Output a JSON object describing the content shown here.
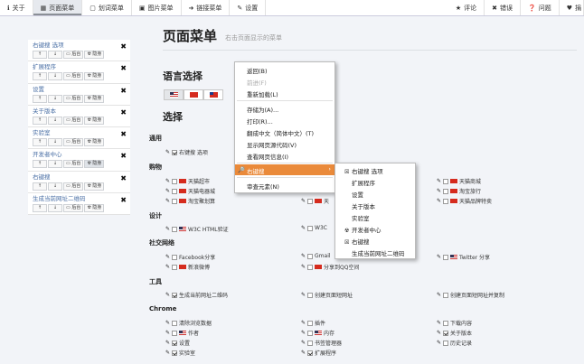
{
  "nav": {
    "tabs": [
      {
        "icon": "info-icon",
        "glyph": "ℹ",
        "label": "关于"
      },
      {
        "icon": "grid-icon",
        "glyph": "▦",
        "label": "页面菜单",
        "active": true
      },
      {
        "icon": "copy-icon",
        "glyph": "▢",
        "label": "划词菜单"
      },
      {
        "icon": "image-icon",
        "glyph": "▣",
        "label": "图片菜单"
      },
      {
        "icon": "link-icon",
        "glyph": "➜",
        "label": "链接菜单"
      },
      {
        "icon": "wrench-icon",
        "glyph": "✎",
        "label": "设置"
      }
    ],
    "right_tabs": [
      {
        "icon": "star-icon",
        "glyph": "★",
        "label": "评论"
      },
      {
        "icon": "close-icon",
        "glyph": "✖",
        "label": "错误"
      },
      {
        "icon": "question-icon",
        "glyph": "❓",
        "label": "问题"
      },
      {
        "icon": "heart-icon",
        "glyph": "♥",
        "label": "捐"
      }
    ]
  },
  "sidebar": {
    "buttons": {
      "up": "↑",
      "down": "↓",
      "back": "▭ 后台",
      "hide": "☢ 隐身"
    },
    "items": [
      {
        "label": "右键搜 选项"
      },
      {
        "label": "扩展程序"
      },
      {
        "label": "设置"
      },
      {
        "label": "关于版本"
      },
      {
        "label": "实验室"
      },
      {
        "label": "开发者中心"
      },
      {
        "label": "右键搜"
      },
      {
        "label": "生成当前网址二维码"
      }
    ]
  },
  "main": {
    "title": "页面菜单",
    "subtitle": "右击页面显示的菜单",
    "lang_title": "语言选择",
    "select_title": "选择",
    "sections": {
      "general": "通用",
      "shopping": "购物",
      "design": "设计",
      "social": "社交网络",
      "tools": "工具",
      "chrome": "Chrome"
    },
    "options": {
      "rs_opt": "右键搜 选项",
      "tmall_super": "天猫超市",
      "tmall_mall": "天猫商城",
      "tmall_elec": "天猫电器城",
      "taobao_travel": "淘宝旅行",
      "taobao_ju": "淘宝聚划算",
      "tmall_brand": "天猫品牌特卖",
      "tian_partial": "天",
      "w3c_html": "W3C HTML验证",
      "w3c_partial": "W3C",
      "facebook": "Facebook分享",
      "gmail_partial": "Gmail",
      "twitter": "Twitter 分享",
      "weibo": "新浪微博",
      "qq": "分享到QQ空间",
      "qr": "生成当前网址二维码",
      "short_url": "创建页面短网址",
      "short_url_copy": "创建页面短网址并复制",
      "clear_data": "清除浏览数据",
      "plugins": "插件",
      "downloads": "下载内容",
      "author": "作者",
      "memory": "内存",
      "about_ver": "关于版本",
      "settings": "设置",
      "bookmarks": "书签管理器",
      "history": "历史记录",
      "lab": "实验室",
      "extensions": "扩展程序"
    }
  },
  "context_menu": {
    "items": [
      {
        "label": "返回(B)"
      },
      {
        "label": "前进(F)",
        "disabled": true
      },
      {
        "label": "重新加载(L)"
      },
      {
        "label": "存储为(A)..."
      },
      {
        "label": "打印(R)..."
      },
      {
        "label": "翻成中文（简体中文）(T)"
      },
      {
        "label": "显示网页源代码(V)"
      },
      {
        "label": "查看网页信息(I)"
      },
      {
        "label": "右键搜"
      },
      {
        "label": "审查元素(N)"
      }
    ],
    "highlight_arrow": "›",
    "submenu": [
      {
        "icon": "☒",
        "label": "右键搜 选项"
      },
      {
        "icon": "",
        "label": "扩展程序"
      },
      {
        "icon": "",
        "label": "设置"
      },
      {
        "icon": "",
        "label": "关于版本"
      },
      {
        "icon": "",
        "label": "实验室"
      },
      {
        "icon": "☢",
        "label": "开发者中心"
      },
      {
        "icon": "☒",
        "label": "右键搜"
      },
      {
        "icon": "",
        "label": "生成当前网址二维码"
      }
    ]
  }
}
